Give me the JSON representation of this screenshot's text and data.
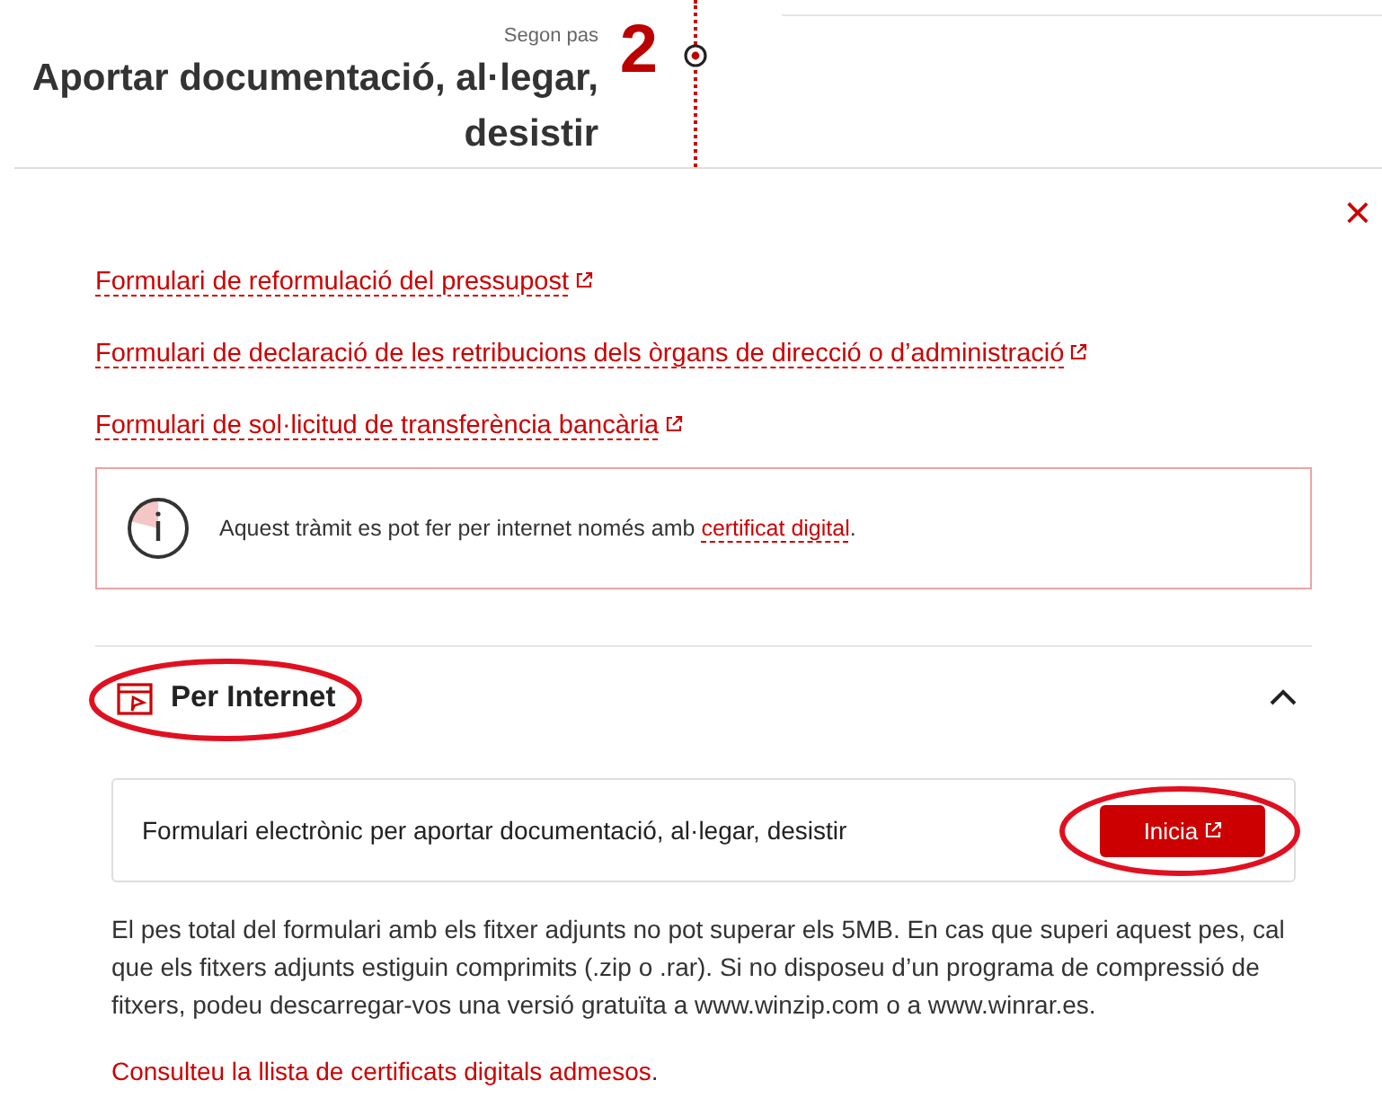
{
  "step": {
    "label": "Segon pas",
    "number": "2",
    "title": "Aportar documentació, al·legar, desistir"
  },
  "close_button": {
    "label": "×"
  },
  "links": [
    {
      "text": "Formulari de reformulació del pressupost",
      "external": true
    },
    {
      "text": "Formulari de declaració de les retribucions dels òrgans de direcció o d’administració",
      "external": true
    },
    {
      "text": "Formulari de sol·licitud de transferència bancària",
      "external": true
    }
  ],
  "notice": {
    "text": "Aquest tràmit es pot fer per internet només amb ",
    "link": "certificat digital",
    "after": "."
  },
  "section": {
    "title": "Per Internet",
    "expanded": true,
    "circled": true,
    "card": {
      "text": "Formulari electrònic per aportar documentació, al·legar, desistir",
      "button": "Inicia",
      "button_circled": true
    },
    "paragraph": "El pes total del formulari amb els fitxer adjunts no pot superar els 5MB. En cas que superi aquest pes, cal que els fitxers adjunts estiguin comprimits (.zip o .rar). Si no disposeu d’un programa de compressió de fitxers, podeu descarregar-vos una versió gratuïta a www.winzip.com o a www.winrar.es.",
    "footer_link": "Consulteu la llista de certificats digitals admesos",
    "footer_after": "."
  }
}
